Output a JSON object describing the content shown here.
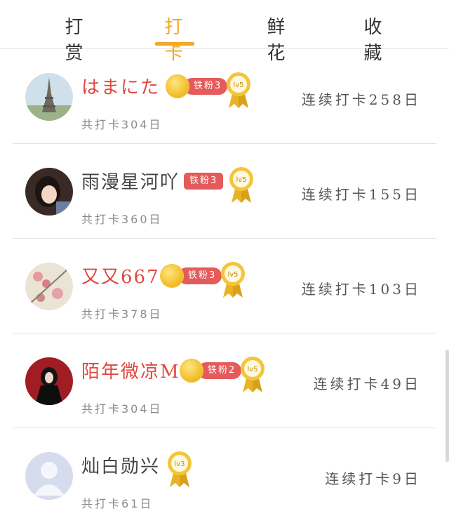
{
  "tabs": [
    "打赏",
    "打卡",
    "鲜花",
    "收藏"
  ],
  "active_tab": 1,
  "colors": {
    "accent": "#f5a623",
    "badge_red": "#e55a5a",
    "name_red": "#e0473f",
    "name_gray": "#444444"
  },
  "rows": [
    {
      "name": "はまにた",
      "badge": "铁粉3",
      "level": "lv5",
      "total": "共打卡304日",
      "streak": "连续打卡258日"
    },
    {
      "name": "雨漫星河吖",
      "badge": "铁粉3",
      "level": "lv5",
      "total": "共打卡360日",
      "streak": "连续打卡155日"
    },
    {
      "name": "又又6676",
      "badge": "铁粉3",
      "level": "lv5",
      "total": "共打卡378日",
      "streak": "连续打卡103日"
    },
    {
      "name": "陌年微凉M",
      "badge": "铁粉2",
      "level": "lv5",
      "total": "共打卡304日",
      "streak": "连续打卡49日"
    },
    {
      "name": "灿白勋兴",
      "badge": "",
      "level": "lv3",
      "total": "共打卡61日",
      "streak": "连续打卡9日"
    }
  ]
}
